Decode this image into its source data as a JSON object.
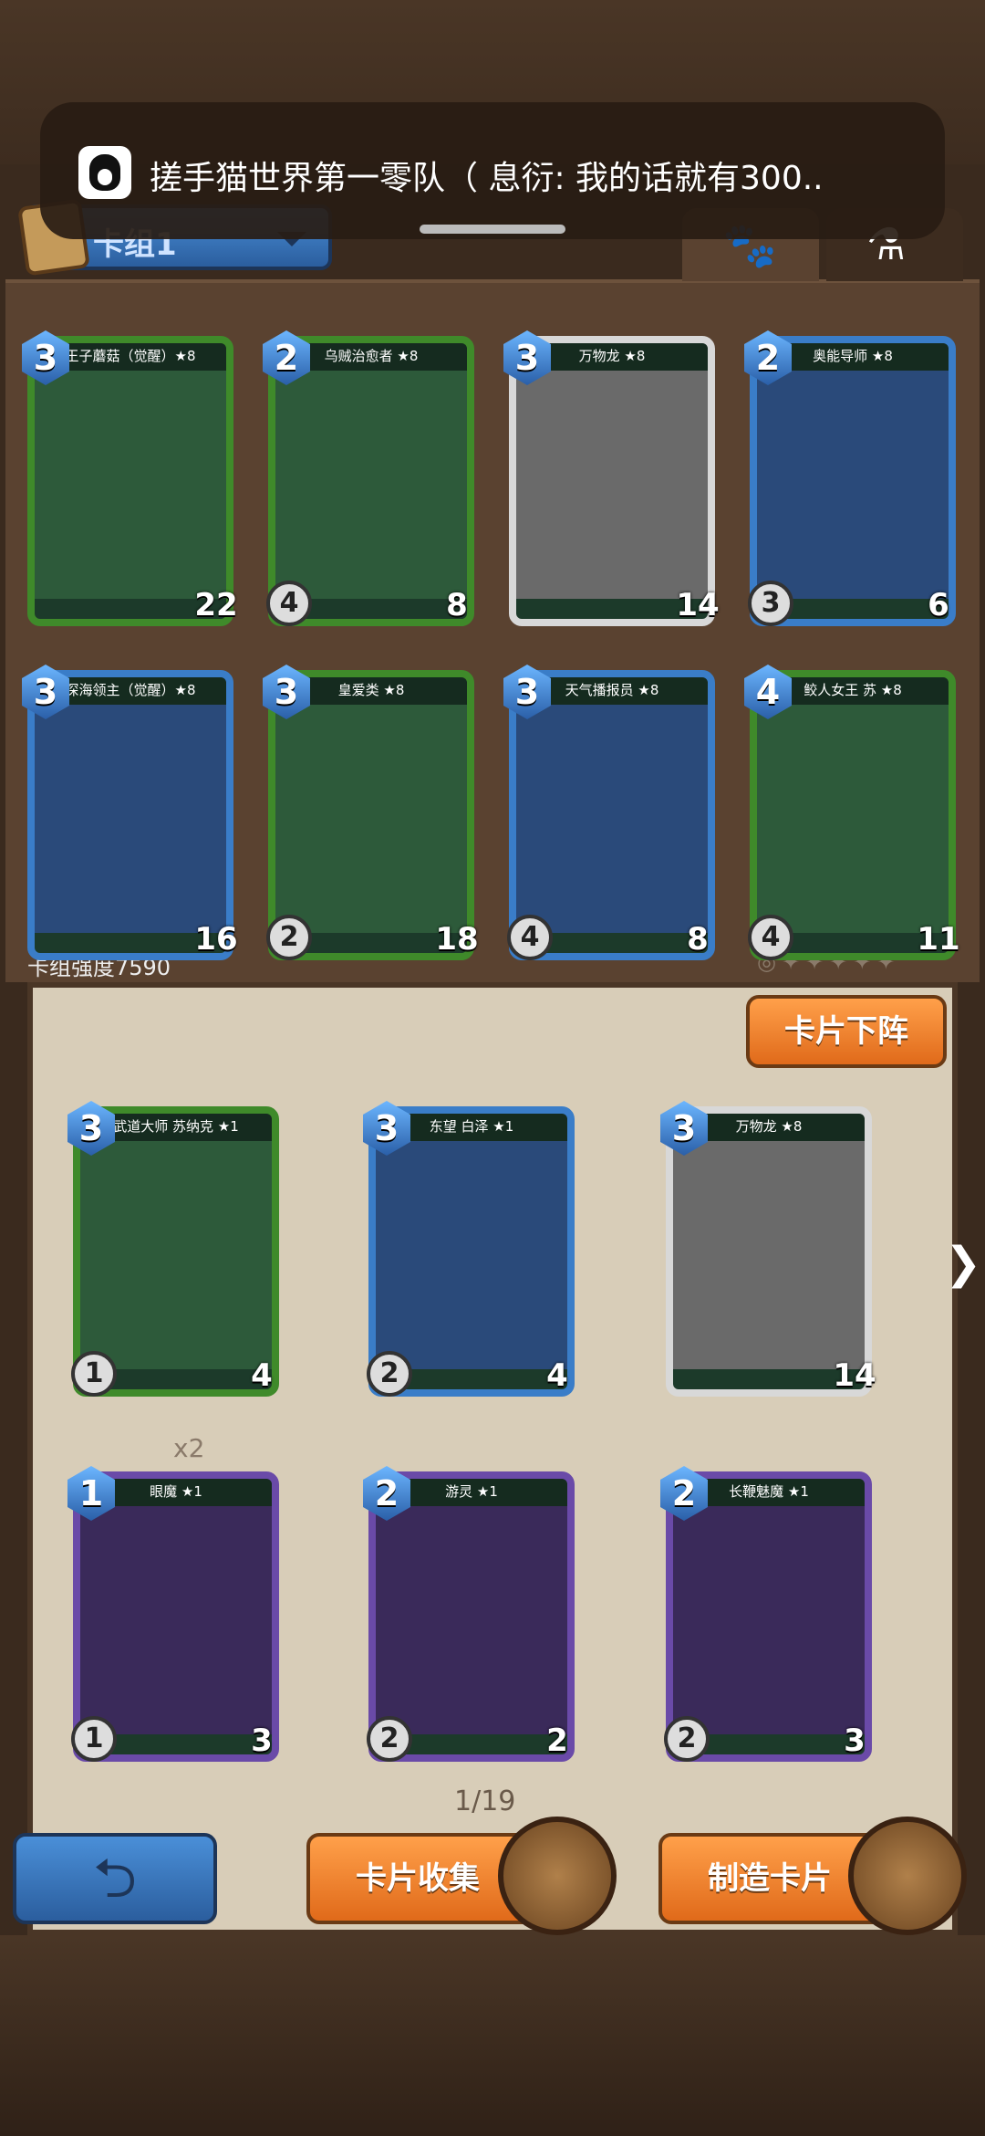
{
  "notification": {
    "app": "QQ",
    "text": "搓手猫世界第一零队（  息衍: 我的话就有300.."
  },
  "deck": {
    "selector_label": "卡组1",
    "power_label": "卡组强度7590"
  },
  "tabs": [
    {
      "name": "paw",
      "icon": "paw-icon"
    },
    {
      "name": "flask",
      "icon": "flask-icon"
    }
  ],
  "deck_cards": [
    {
      "name": "王子蘑菇（觉醒）★8",
      "cost": "3",
      "hp": "22",
      "frame": "green"
    },
    {
      "name": "乌贼治愈者 ★8",
      "cost": "2",
      "atk": "4",
      "hp": "8",
      "frame": "green"
    },
    {
      "name": "万物龙 ★8",
      "cost": "3",
      "hp": "14",
      "frame": "white"
    },
    {
      "name": "奥能导师 ★8",
      "cost": "2",
      "atk": "3",
      "hp": "6",
      "frame": "blue"
    },
    {
      "name": "深海领主（觉醒）★8",
      "cost": "3",
      "hp": "16",
      "frame": "blue"
    },
    {
      "name": "皇爱类 ★8",
      "cost": "3",
      "atk": "2",
      "hp": "18",
      "frame": "green"
    },
    {
      "name": "天气播报员 ★8",
      "cost": "3",
      "atk": "4",
      "hp": "8",
      "frame": "blue"
    },
    {
      "name": "鲛人女王 苏 ★8",
      "cost": "4",
      "atk": "4",
      "hp": "11",
      "frame": "green"
    }
  ],
  "actions": {
    "deploy": "卡片下阵",
    "collect": "卡片收集",
    "craft": "制造卡片"
  },
  "collection_cards": [
    {
      "name": "武道大师 苏纳克 ★1",
      "cost": "3",
      "atk": "1",
      "hp": "4",
      "frame": "green"
    },
    {
      "name": "东望 白泽 ★1",
      "cost": "3",
      "atk": "2",
      "hp": "4",
      "frame": "blue"
    },
    {
      "name": "万物龙 ★8",
      "cost": "3",
      "hp": "14",
      "frame": "white"
    },
    {
      "name": "眼魔 ★1",
      "cost": "1",
      "atk": "1",
      "hp": "3",
      "frame": "purple"
    },
    {
      "name": "游灵 ★1",
      "cost": "2",
      "atk": "2",
      "hp": "2",
      "frame": "purple"
    },
    {
      "name": "长鞭魅魔 ★1",
      "cost": "2",
      "atk": "2",
      "hp": "3",
      "frame": "purple"
    }
  ],
  "collection": {
    "multiplier": "x2",
    "page": "1/19"
  }
}
